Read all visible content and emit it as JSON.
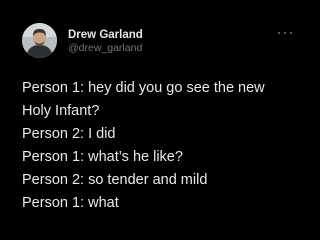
{
  "author": {
    "display_name": "Drew Garland",
    "handle": "@drew_garland",
    "avatar_icon": "person-photo-avatar"
  },
  "more_menu": {
    "icon": "more-horizontal-icon"
  },
  "tweet": {
    "lines": [
      "Person 1: hey did you go see the new",
      "Holy Infant?",
      "Person 2: I did",
      "Person 1: what’s he like?",
      "Person 2: so tender and mild",
      "Person 1: what"
    ]
  },
  "colors": {
    "background": "#000000",
    "primary_text": "#e7e9ea",
    "secondary_text": "#71767b"
  }
}
